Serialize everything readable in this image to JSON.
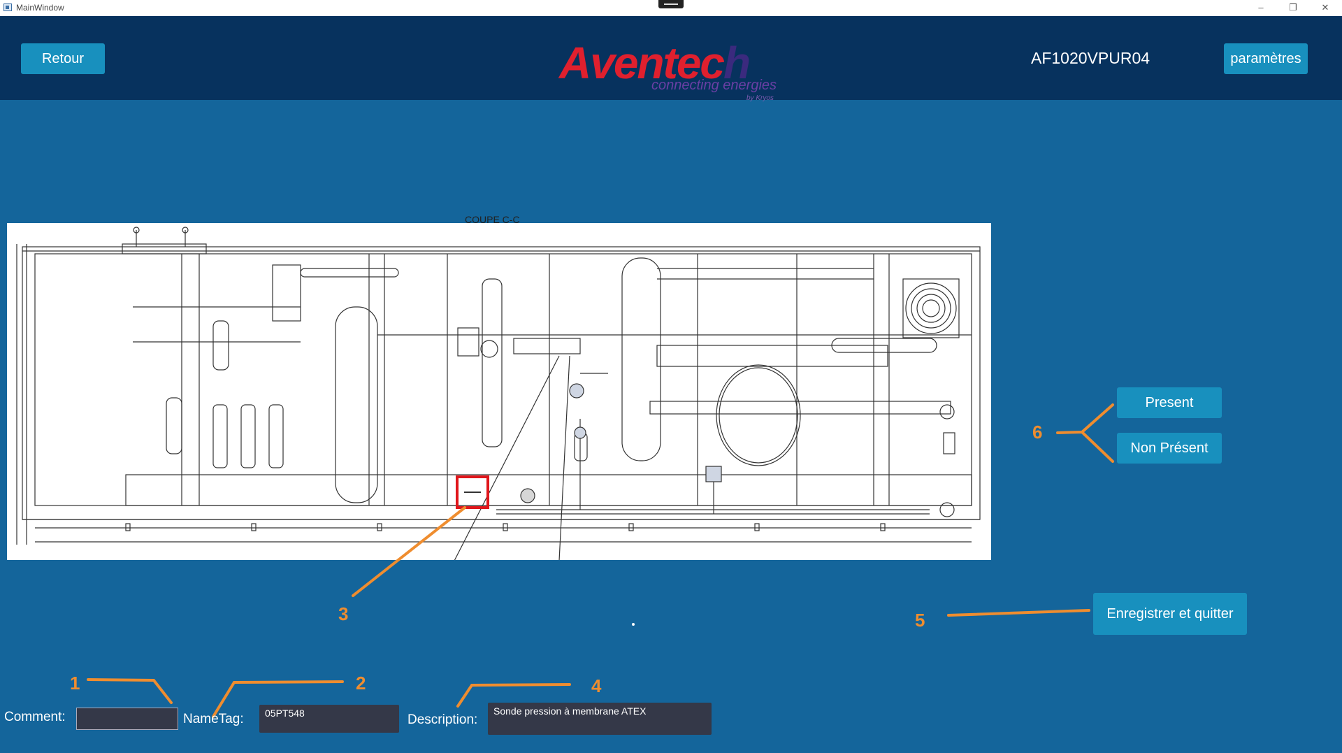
{
  "window": {
    "title": "MainWindow",
    "controls": {
      "minimize": "–",
      "restore": "❐",
      "close": "✕"
    }
  },
  "header": {
    "back_label": "Retour",
    "logo": {
      "word_main": "Aventec",
      "word_tail": "h",
      "tagline": "connecting energies",
      "byline": "by Kryos"
    },
    "machine_id": "AF1020VPUR04",
    "settings_label": "paramètres"
  },
  "diagram": {
    "section_label": "COUPE C-C",
    "highlight_color": "#e0161b"
  },
  "status_buttons": {
    "present_label": "Present",
    "absent_label": "Non Présent"
  },
  "save_label": "Enregistrer et quitter",
  "form": {
    "comment_label": "Comment:",
    "comment_value": "",
    "nametag_label": "NameTag:",
    "nametag_value": "05PT548",
    "description_label": "Description:",
    "description_value": "Sonde pression à membrane ATEX"
  },
  "annotations": [
    "1",
    "2",
    "3",
    "4",
    "5",
    "6"
  ],
  "colors": {
    "background": "#14659b",
    "header": "#07325e",
    "button": "#1890be",
    "annotation": "#ef8d2f",
    "field": "#343848"
  }
}
